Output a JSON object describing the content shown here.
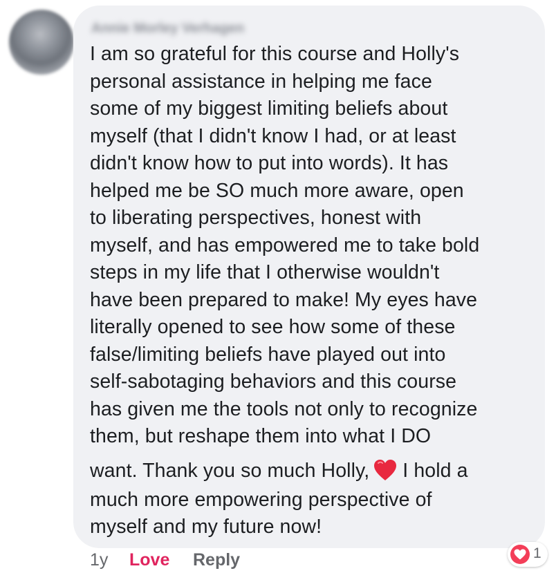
{
  "comment": {
    "author_name": "Annie Morley Verhagen",
    "lines": [
      "I am so grateful for this course and Holly's",
      "personal assistance in helping me face",
      "some of my biggest limiting beliefs about",
      "myself (that I didn't know I had, or at least",
      "didn't know how to put into words). It has",
      "helped me be SO much more aware, open",
      "to liberating perspectives, honest with",
      "myself, and has empowered me to take bold",
      "steps in my life that I otherwise wouldn't",
      "have been prepared to make! My eyes have",
      "literally opened to see how some of these",
      "false/limiting beliefs have played out into",
      "self-sabotaging behaviors and this course",
      "has given me the tools not only to recognize",
      "them, but reshape them into what I DO"
    ],
    "heart_line_before": "want. Thank you so much Holly,",
    "heart_line_after": "I hold a",
    "closing_lines": [
      "much more empowering perspective of",
      "myself and my future now!"
    ],
    "inline_icon": "red-heart-emoji-icon"
  },
  "footer": {
    "time": "1y",
    "love_label": "Love",
    "reply_label": "Reply"
  },
  "reactions": {
    "icon": "love-reaction-icon",
    "count": "1"
  },
  "colors": {
    "bubble": "#f0f1f4",
    "text": "#1c1e21",
    "love": "#e0245e",
    "muted": "#65676b",
    "heart": "#f33e58"
  }
}
